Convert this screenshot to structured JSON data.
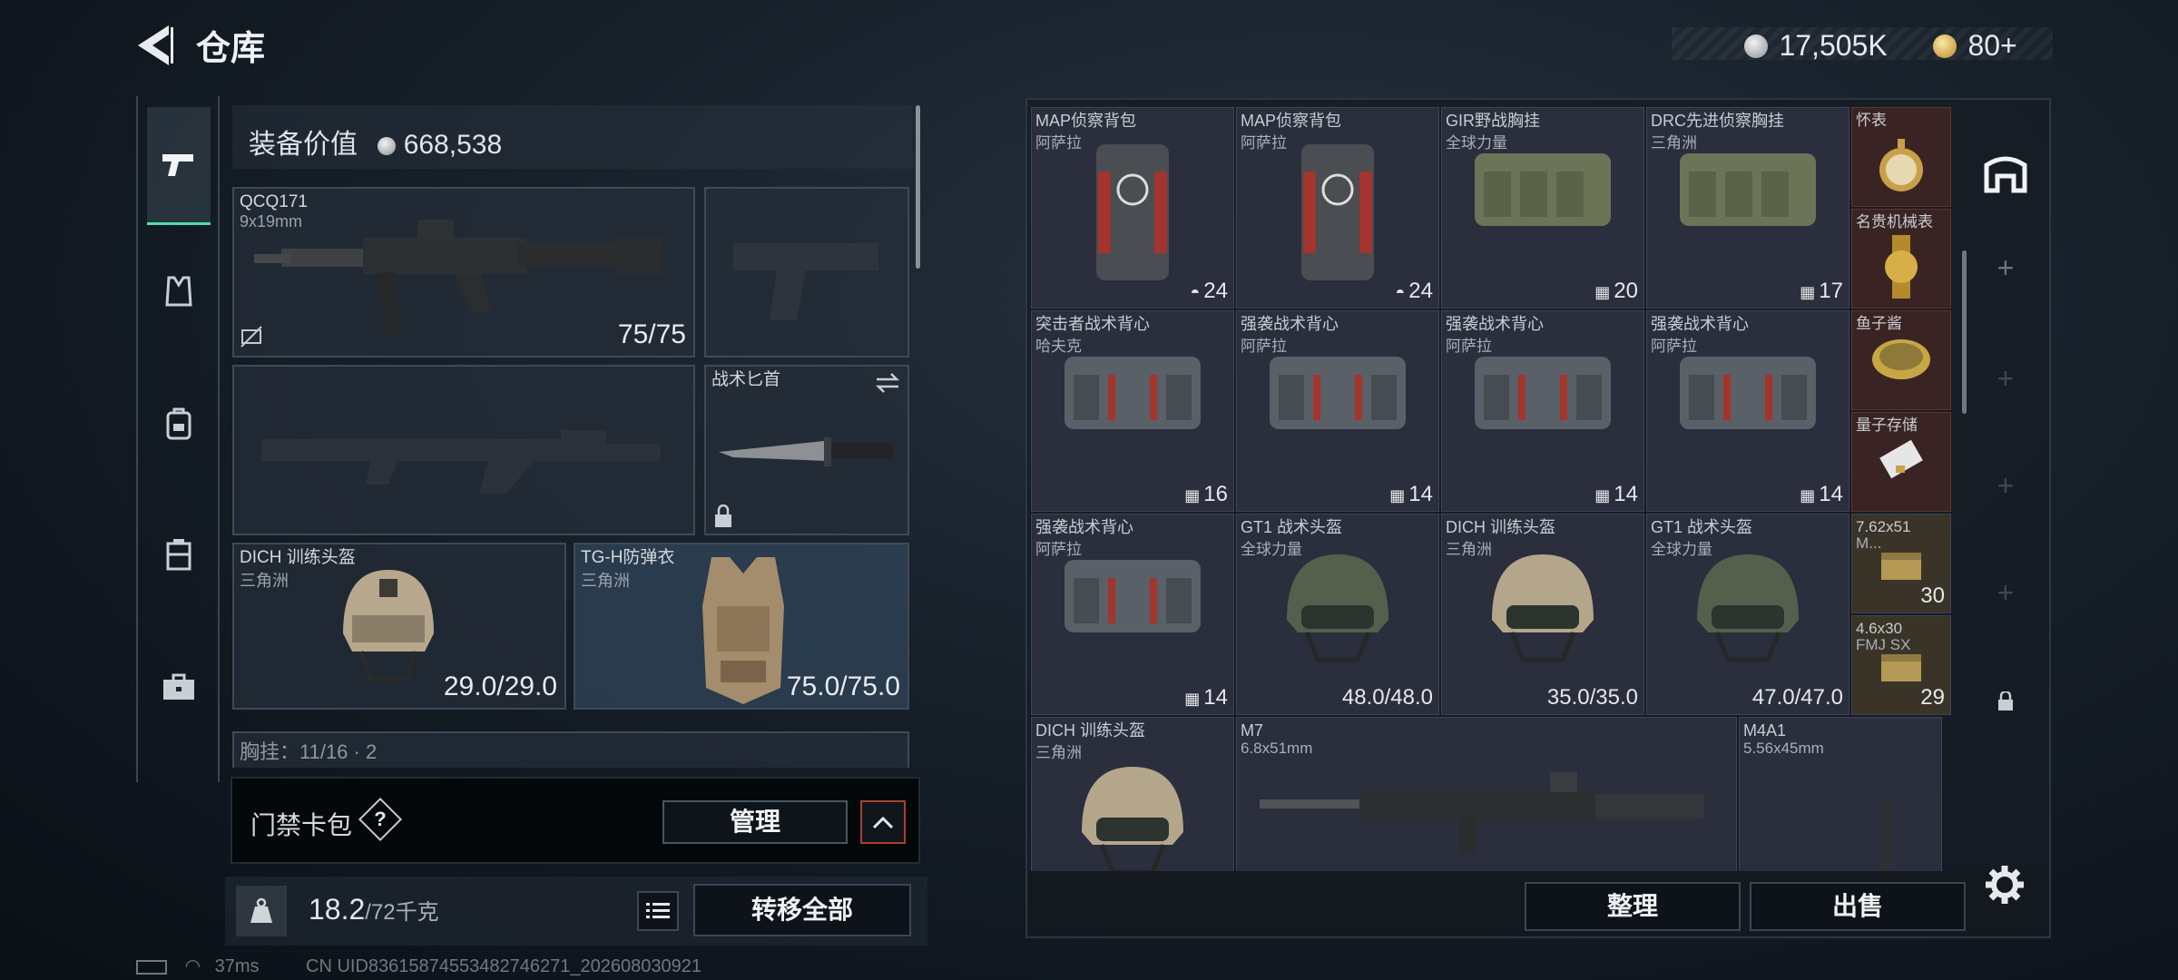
{
  "header": {
    "title": "仓库",
    "currency_silver": "17,505K",
    "currency_gold": "80+"
  },
  "left_rail": {
    "items": [
      {
        "icon": "pistol-icon",
        "active": true
      },
      {
        "icon": "vest-icon",
        "active": false
      },
      {
        "icon": "backpack-icon",
        "active": false
      },
      {
        "icon": "container-icon",
        "active": false
      },
      {
        "icon": "briefcase-icon",
        "active": false
      }
    ]
  },
  "loadout": {
    "equip_value_label": "装备价值",
    "equip_value": "668,538",
    "primary_weapon": {
      "name": "QCQ171",
      "caliber": "9x19mm",
      "ammo": "75/75"
    },
    "knife": {
      "name": "战术匕首"
    },
    "helmet": {
      "name": "DICH 训练头盔",
      "maker": "三角洲",
      "durability": "29.0/29.0"
    },
    "armor": {
      "name": "TG-H防弹衣",
      "maker": "三角洲",
      "durability": "75.0/75.0"
    },
    "chest_rig_partial": "胸挂：11/16 · 2"
  },
  "card_pack": {
    "label": "门禁卡包",
    "help": "?",
    "manage": "管理"
  },
  "bottom_bar": {
    "weight": "18.2",
    "weight_max": "/72千克",
    "transfer_all": "转移全部"
  },
  "status": {
    "ping": "37ms",
    "uid": "CN UID836158745534827462​71_202608030921"
  },
  "storage": {
    "items": [
      {
        "name": "MAP侦察背包",
        "maker": "阿萨拉",
        "count": "24",
        "icon": "helmet-small-icon"
      },
      {
        "name": "MAP侦察背包",
        "maker": "阿萨拉",
        "count": "24",
        "icon": "helmet-small-icon"
      },
      {
        "name": "GIR野战胸挂",
        "maker": "全球力量",
        "count": "20",
        "icon": "vest-small-icon"
      },
      {
        "name": "DRC先进侦察胸挂",
        "maker": "三角洲",
        "count": "17",
        "icon": "vest-small-icon"
      },
      {
        "name": "突击者战术背心",
        "maker": "哈夫克",
        "count": "16",
        "icon": "vest-small-icon"
      },
      {
        "name": "强袭战术背心",
        "maker": "阿萨拉",
        "count": "14",
        "icon": "vest-small-icon"
      },
      {
        "name": "强袭战术背心",
        "maker": "阿萨拉",
        "count": "14",
        "icon": "vest-small-icon"
      },
      {
        "name": "强袭战术背心",
        "maker": "阿萨拉",
        "count": "14",
        "icon": "vest-small-icon"
      },
      {
        "name": "强袭战术背心",
        "maker": "阿萨拉",
        "count": "14",
        "icon": "vest-small-icon"
      },
      {
        "name": "GT1 战术头盔",
        "maker": "全球力量",
        "count": "48.0/48.0"
      },
      {
        "name": "DICH 训练头盔",
        "maker": "三角洲",
        "count": "35.0/35.0"
      },
      {
        "name": "GT1 战术头盔",
        "maker": "全球力量",
        "count": "47.0/47.0"
      },
      {
        "name": "DICH 训练头盔",
        "maker": "三角洲",
        "count": ""
      },
      {
        "name": "M7",
        "maker": "6.8x51mm",
        "count": ""
      },
      {
        "name": "M4A1",
        "maker": "5.56x45mm",
        "count": ""
      }
    ],
    "side_items": [
      {
        "name": "怀表"
      },
      {
        "name": "名贵机械表"
      },
      {
        "name": "鱼子酱"
      },
      {
        "name": "量子存储"
      },
      {
        "name": "7.62x51",
        "sub": "M...",
        "count": "30"
      },
      {
        "name": "4.6x30",
        "sub": "FMJ SX",
        "count": "29"
      }
    ],
    "sort": "整理",
    "sell": "出售"
  }
}
